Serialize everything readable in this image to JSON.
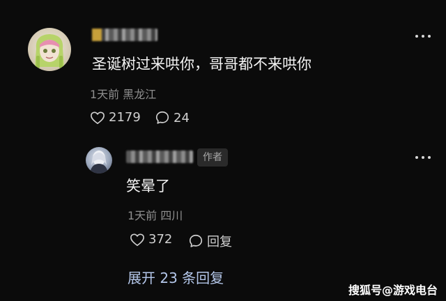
{
  "comment": {
    "text": "圣诞树过来哄你，哥哥都不来哄你",
    "meta": "1天前 黑龙江",
    "likes": "2179",
    "replies": "24"
  },
  "reply": {
    "author_tag": "作者",
    "text": "笑晕了",
    "meta": "1天前 四川",
    "likes": "372",
    "reply_label": "回复"
  },
  "expand_label": "展开 23 条回复",
  "watermark": "搜狐号@游戏电台",
  "colors": {
    "background": "#0b0b0b",
    "primary_text": "#f5f5f5",
    "secondary_text": "#8f8f8f",
    "link": "#b4c7ea"
  },
  "icons": {
    "like": "heart-outline-icon",
    "comment": "speech-bubble-icon",
    "more": "more-dots-icon"
  }
}
